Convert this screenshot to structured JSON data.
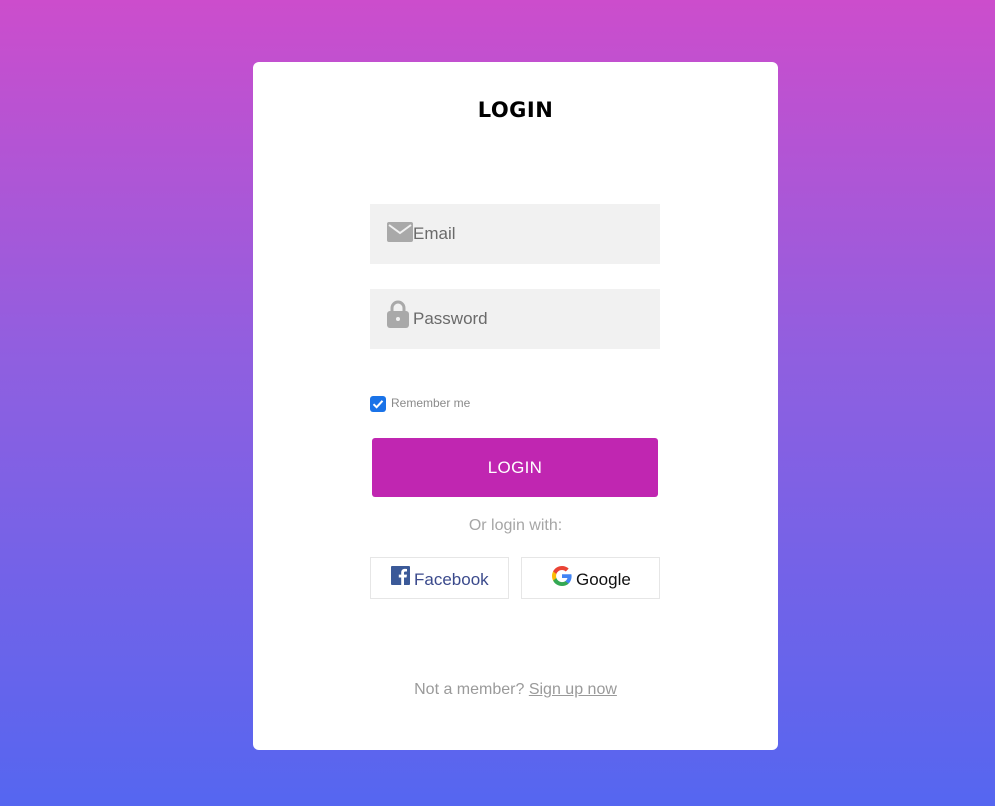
{
  "card": {
    "title": "LOGIN",
    "email": {
      "placeholder": "Email",
      "value": ""
    },
    "password": {
      "placeholder": "Password",
      "value": ""
    },
    "remember": {
      "label": "Remember me",
      "checked": true
    },
    "login_button": "LOGIN",
    "or_text": "Or login with:",
    "social": {
      "facebook_label": "Facebook",
      "google_label": "Google"
    },
    "footer": {
      "prompt": "Not a member?",
      "signup_link": "Sign up now"
    }
  },
  "colors": {
    "accent": "#c026b1",
    "checkbox": "#1a73e8",
    "facebook": "#3b5998",
    "background_top": "#cc4dcc",
    "background_bottom": "#5566f0"
  },
  "icons": {
    "email": "envelope-icon",
    "password": "lock-icon",
    "facebook": "facebook-icon",
    "google": "google-icon",
    "checkbox": "checkmark-icon"
  }
}
